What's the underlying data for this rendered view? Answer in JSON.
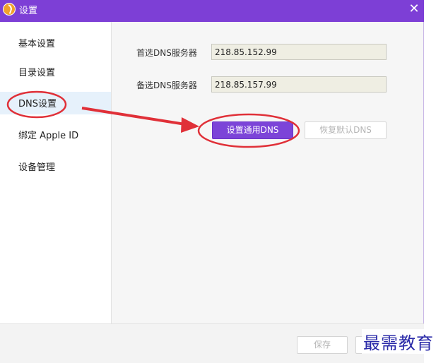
{
  "window": {
    "title": "设置",
    "close_glyph": "✕"
  },
  "sidebar": {
    "items": [
      {
        "label": "基本设置",
        "active": false
      },
      {
        "label": "目录设置",
        "active": false
      },
      {
        "label": "DNS设置",
        "active": true
      },
      {
        "label": "绑定 Apple ID",
        "active": false
      },
      {
        "label": "设备管理",
        "active": false
      }
    ]
  },
  "dns": {
    "primary_label": "首选DNS服务器",
    "primary_value": "218.85.152.99",
    "secondary_label": "备选DNS服务器",
    "secondary_value": "218.85.157.99",
    "set_button": "设置通用DNS",
    "restore_button": "恢复默认DNS"
  },
  "footer": {
    "save_button": "保存"
  },
  "watermark": "最需教育",
  "colors": {
    "titlebar": "#7d3fd6",
    "primary_button": "#7c44d8",
    "annotation": "#e03038",
    "sidebar_active": "#e6f1fb"
  },
  "icons": {
    "app": "app-logo-icon",
    "close": "close-icon"
  }
}
